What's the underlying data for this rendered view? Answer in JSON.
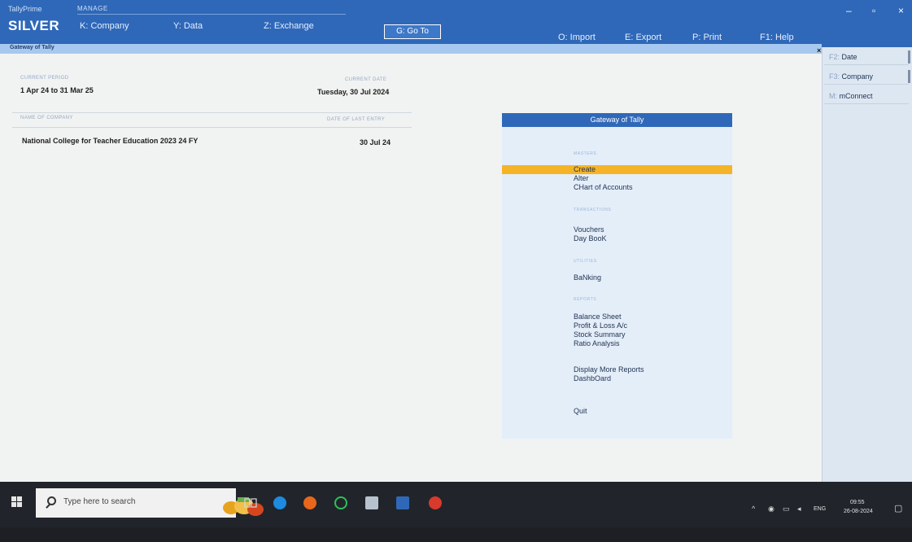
{
  "header": {
    "product": "TallyPrime",
    "mode": "MANAGE",
    "edition": "SILVER",
    "menu": [
      {
        "label": "K: Company"
      },
      {
        "label": "Y: Data"
      },
      {
        "label": "Z: Exchange"
      },
      {
        "label": "G: Go To"
      },
      {
        "label": "O: Import"
      },
      {
        "label": "E: Export"
      },
      {
        "label": "P: Print"
      },
      {
        "label": "F1: Help"
      }
    ],
    "window_controls": {
      "minimize": "–",
      "maximize": "▫",
      "close": "×"
    }
  },
  "subbar": {
    "title": "Gateway of Tally",
    "close": "×"
  },
  "main": {
    "current_period_label": "CURRENT PERIOD",
    "current_period": "1 Apr 24 to 31 Mar 25",
    "current_date_label": "CURRENT DATE",
    "current_date": "Tuesday, 30 Jul 2024",
    "company_name_label": "NAME OF COMPANY",
    "last_entry_label": "DATE OF LAST ENTRY",
    "company_name": "National College for Teacher Education 2023 24 FY",
    "last_entry_date": "30 Jul 24"
  },
  "gateway": {
    "title": "Gateway of Tally",
    "masters_label": "MASTERS",
    "masters": [
      "Create",
      "Alter",
      "CHart of Accounts"
    ],
    "transactions_label": "TRANSACTIONS",
    "transactions": [
      "Vouchers",
      "Day BooK"
    ],
    "utilities_label": "UTILITIES",
    "utilities": [
      "BaNking"
    ],
    "reports_label": "REPORTS",
    "reports": [
      "Balance Sheet",
      "Profit & Loss A/c",
      "Stock Summary",
      "Ratio Analysis"
    ],
    "more": [
      "Display More Reports",
      "DashbOard"
    ],
    "quit": "Quit"
  },
  "right_panel": [
    {
      "key": "F2:",
      "label": "Date"
    },
    {
      "key": "F3:",
      "label": "Company"
    },
    {
      "key": "M:",
      "label": "mConnect"
    }
  ],
  "taskbar": {
    "search_placeholder": "Type here to search",
    "language": "ENG",
    "time": "09:55",
    "date": "26-08-2024"
  },
  "colors": {
    "header_blue": "#2f68b8",
    "highlight": "#f5b428",
    "panel_bg": "#e4eef9"
  }
}
